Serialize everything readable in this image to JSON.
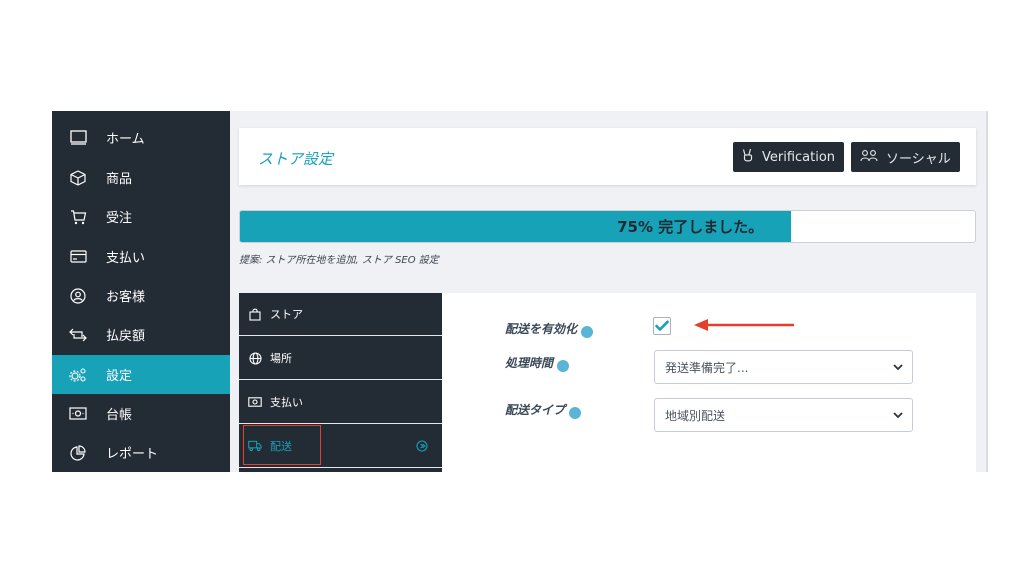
{
  "sidebar": {
    "items": [
      {
        "label": "ホーム",
        "icon": "monitor-icon"
      },
      {
        "label": "商品",
        "icon": "box-icon"
      },
      {
        "label": "受注",
        "icon": "cart-icon"
      },
      {
        "label": "支払い",
        "icon": "credit-card-icon"
      },
      {
        "label": "お客様",
        "icon": "user-circle-icon"
      },
      {
        "label": "払戻額",
        "icon": "refund-icon"
      },
      {
        "label": "設定",
        "icon": "gears-icon",
        "active": true
      },
      {
        "label": "台帳",
        "icon": "money-icon"
      },
      {
        "label": "レポート",
        "icon": "pie-chart-icon"
      }
    ]
  },
  "header": {
    "title": "ストア設定",
    "verification_label": "Verification",
    "social_label": "ソーシャル"
  },
  "progress": {
    "percent": 75,
    "label": "75% 完了しました。"
  },
  "suggestion": "提案: ストア所在地を追加, ストア SEO 設定",
  "subnav": {
    "items": [
      {
        "label": "ストア",
        "icon": "bag-icon"
      },
      {
        "label": "場所",
        "icon": "globe-icon"
      },
      {
        "label": "支払い",
        "icon": "money-icon"
      },
      {
        "label": "配送",
        "icon": "truck-icon",
        "active": true
      }
    ]
  },
  "form": {
    "enable_shipping_label": "配送を有効化",
    "enable_shipping_checked": true,
    "processing_time_label": "処理時間",
    "processing_time_value": "発送準備完了...",
    "shipping_type_label": "配送タイプ",
    "shipping_type_value": "地域別配送"
  },
  "colors": {
    "sidebar_bg": "#232b34",
    "accent": "#17a2b8",
    "annotation_red": "#e2402a"
  }
}
